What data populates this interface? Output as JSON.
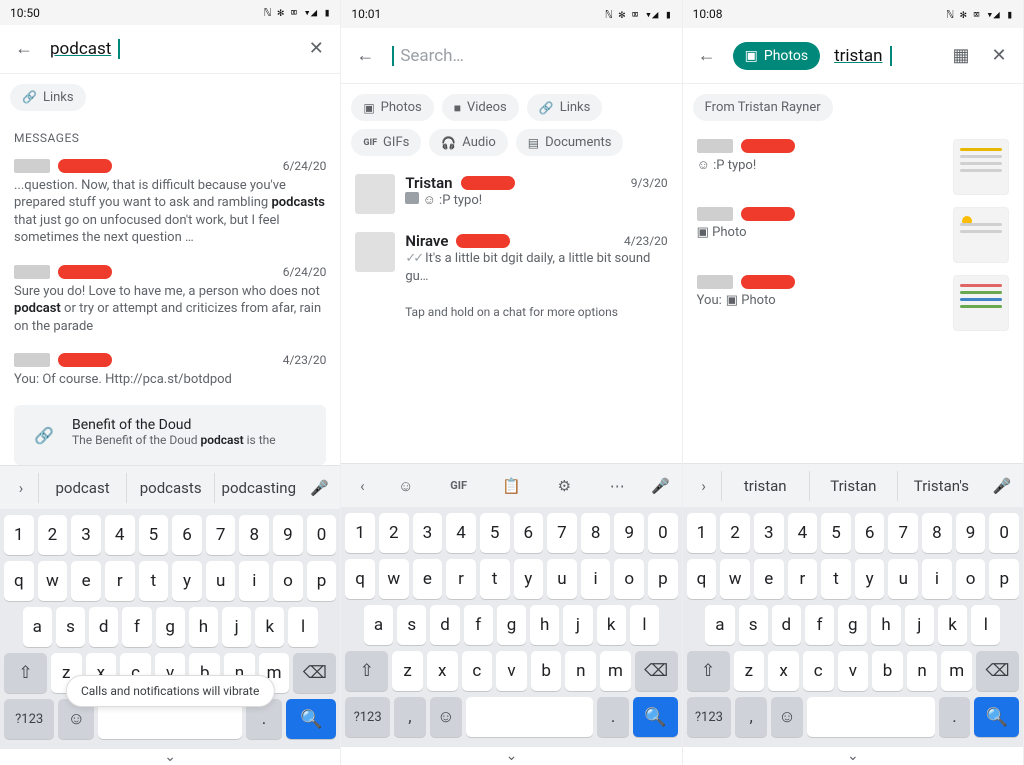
{
  "panels": [
    {
      "time": "10:50",
      "status_icons": "ℕ ✻ ⌧ ▾◢ ▮",
      "search_query": "podcast",
      "search_placeholder": "",
      "photos_active": false,
      "close_x": true,
      "chips": [
        {
          "icon": "🔗",
          "label": "Links"
        }
      ],
      "section": "MESSAGES",
      "messages": [
        {
          "date": "6/24/20",
          "text_pre": "...question. Now, that is difficult because you've prepared stuff you want to ask and rambling ",
          "kw": "podcasts",
          "text_post": " that just go on unfocused don't work, but I feel sometimes the next question …"
        },
        {
          "date": "6/24/20",
          "text_pre": "Sure you do! Love to have me, a person who does not ",
          "kw": "podcast",
          "text_post": " or try or attempt and criticizes from afar, rain on the parade"
        },
        {
          "date": "4/23/20",
          "text_pre": "You: Of course. Http://pca.st/botdpod",
          "kw": "",
          "text_post": ""
        }
      ],
      "link_card": {
        "title": "Benefit of the Doud",
        "desc_pre": "The Benefit of the Doud ",
        "desc_kw": "podcast",
        "desc_post": " is the"
      },
      "suggestions": {
        "type": "words",
        "arrow": "›",
        "items": [
          "podcast",
          "podcasts",
          "podcasting"
        ]
      },
      "toast": "Calls and notifications will vibrate"
    },
    {
      "time": "10:01",
      "status_icons": "ℕ ✻ ⌧ ▾◢ ▮",
      "search_query": "",
      "search_placeholder": "Search…",
      "photos_active": false,
      "close_x": false,
      "chips": [
        {
          "icon": "▣",
          "label": "Photos"
        },
        {
          "icon": "■",
          "label": "Videos"
        },
        {
          "icon": "🔗",
          "label": "Links"
        },
        {
          "icon": "GIF",
          "label": "GIFs"
        },
        {
          "icon": "🎧",
          "label": "Audio"
        },
        {
          "icon": "▤",
          "label": "Documents"
        }
      ],
      "results": [
        {
          "name": "Tristan",
          "date": "9/3/20",
          "caption": "☺ :P typo!",
          "has_pic": true
        },
        {
          "name": "Nirave",
          "date": "4/23/20",
          "caption": "It's a little bit dgit daily, a little bit sound gu…",
          "ticks": true
        }
      ],
      "hint": "Tap and hold on a chat for more options",
      "suggestions": {
        "type": "toolbar",
        "arrow": "‹",
        "items": [
          "☺",
          "GIF",
          "📋",
          "⚙",
          "⋯"
        ]
      }
    },
    {
      "time": "10:08",
      "status_icons": "ℕ ✻ ⌧ ▾◢ ▮",
      "search_query": "tristan",
      "search_placeholder": "",
      "photos_active": true,
      "photos_label": "Photos",
      "close_x": true,
      "grid_icon": true,
      "chips": [
        {
          "icon": "",
          "label": "From Tristan Rayner"
        }
      ],
      "thumb_results": [
        {
          "caption": "☺ :P typo!"
        },
        {
          "caption": "▣ Photo"
        },
        {
          "caption_pre": "You: ",
          "caption": "▣ Photo"
        }
      ],
      "suggestions": {
        "type": "words",
        "arrow": "›",
        "items": [
          "tristan",
          "Tristan",
          "Tristan's"
        ]
      }
    }
  ],
  "keyboard": {
    "row_num": [
      "1",
      "2",
      "3",
      "4",
      "5",
      "6",
      "7",
      "8",
      "9",
      "0"
    ],
    "row1": [
      "q",
      "w",
      "e",
      "r",
      "t",
      "y",
      "u",
      "i",
      "o",
      "p"
    ],
    "row2": [
      "a",
      "s",
      "d",
      "f",
      "g",
      "h",
      "j",
      "k",
      "l"
    ],
    "row3": [
      "z",
      "x",
      "c",
      "v",
      "b",
      "n",
      "m"
    ],
    "shift": "⇧",
    "bksp": "⌫",
    "sym": "?123",
    "comma": ",",
    "emoji": "☺",
    "period": ".",
    "search": "🔍",
    "mic": "🎤"
  }
}
